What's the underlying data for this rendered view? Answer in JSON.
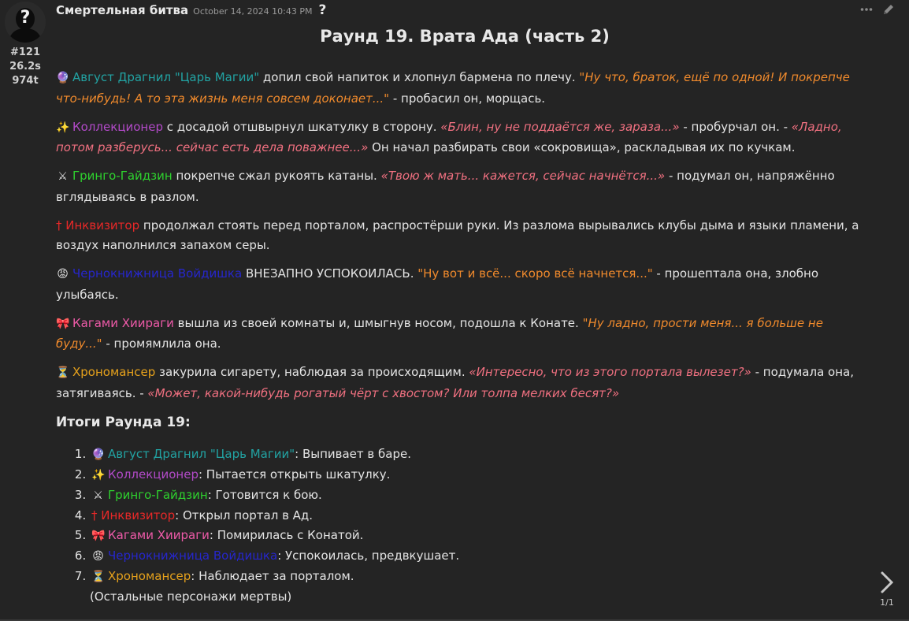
{
  "post": {
    "author": "Смертельная битва",
    "date": "October 14, 2024 10:43 PM",
    "question_mark": "?",
    "stats": [
      "#121",
      "26.2s",
      "974t"
    ],
    "title": "Раунд 19. Врата Ада (часть 2)"
  },
  "paragraphs": {
    "p1": {
      "name": "Август Драгнил \"Царь Магии\"",
      "text1": " допил свой напиток и хлопнул бармена по плечу. ",
      "quote1": "\"Ну что, браток, ещё по одной! И покрепче что-нибудь! А то эта жизнь меня совсем доконает...\"",
      "text2": " - пробасил он, морщась."
    },
    "p2": {
      "name": "Коллекционер",
      "text1": " с досадой отшвырнул шкатулку в сторону. ",
      "quote1": "«Блин, ну не поддаётся же, зараза...»",
      "text2": " - пробурчал он. - ",
      "quote2": "«Ладно, потом разберусь... сейчас есть дела поважнее...»",
      "text3": " Он начал разбирать свои «сокровища», раскладывая их по кучкам."
    },
    "p3": {
      "name": "Гринго-Гайдзин",
      "text1": " покрепче сжал рукоять катаны. ",
      "quote1": "«Твою ж мать... кажется, сейчас начнётся...»",
      "text2": " - подумал он, напряжённо вглядываясь в разлом."
    },
    "p4": {
      "name": "Инквизитор",
      "text1": " продолжал стоять перед порталом, распростёрши руки. Из разлома вырывались клубы дыма и языки пламени, а воздух наполнился запахом серы."
    },
    "p5": {
      "name": "Чернокнижница Войдишка",
      "text1": " ВНЕЗАПНО УСПОКОИЛАСЬ. ",
      "quote1": "\"Ну вот и всё... скоро всё начнется...\"",
      "text2": " - прошептала она, злобно улыбаясь."
    },
    "p6": {
      "name": "Кагами Хиираги",
      "text1": " вышла из своей комнаты и, шмыгнув носом, подошла к Конате. ",
      "quote1": "\"Ну ладно, прости меня... я больше не буду...\"",
      "text2": " - промямлила она."
    },
    "p7": {
      "name": "Хрономансер",
      "text1": " закурила сигарету, наблюдая за происходящим. ",
      "quote1": "«Интересно, что из этого портала вылезет?»",
      "text2": " - подумала она, затягиваясь. - ",
      "quote2": "«Может, какой-нибудь рогатый чёрт с хвостом? Или толпа мелких бесят?»"
    }
  },
  "summary": {
    "title": "Итоги Раунда 19:",
    "items": [
      {
        "name": "Август Драгнил \"Царь Магии\"",
        "text": ": Выпивает в баре."
      },
      {
        "name": "Коллекционер",
        "text": ": Пытается открыть шкатулку."
      },
      {
        "name": "Гринго-Гайдзин",
        "text": ": Готовится к бою."
      },
      {
        "name": "Инквизитор",
        "text": ": Открыл портал в Ад."
      },
      {
        "name": "Кагами Хиираги",
        "text": ": Помирилась с Конатой."
      },
      {
        "name": "Чернокнижница Войдишка",
        "text": ": Успокоилась, предвкушает."
      },
      {
        "name": "Хрономансер",
        "text": ": Наблюдает за порталом."
      }
    ],
    "note": "(Остальные персонажи мертвы)"
  },
  "icons": {
    "magic": "🔮",
    "sparkle": "✨",
    "swords": "⚔",
    "cross": "†",
    "devil": "😡",
    "ribbon": "🎀",
    "hourglass": "⏳"
  },
  "pager": {
    "count": "1/1"
  },
  "colors": {
    "background": "#242424",
    "teal": "#22a3a3",
    "purple": "#b24ac8",
    "green": "#2ed12e",
    "red": "#e82828",
    "blue": "#2626cc",
    "pink": "#ee5aa8",
    "gold": "#e5a11c",
    "quote_orange": "#f08a2c",
    "quote_pink": "#f07080"
  }
}
